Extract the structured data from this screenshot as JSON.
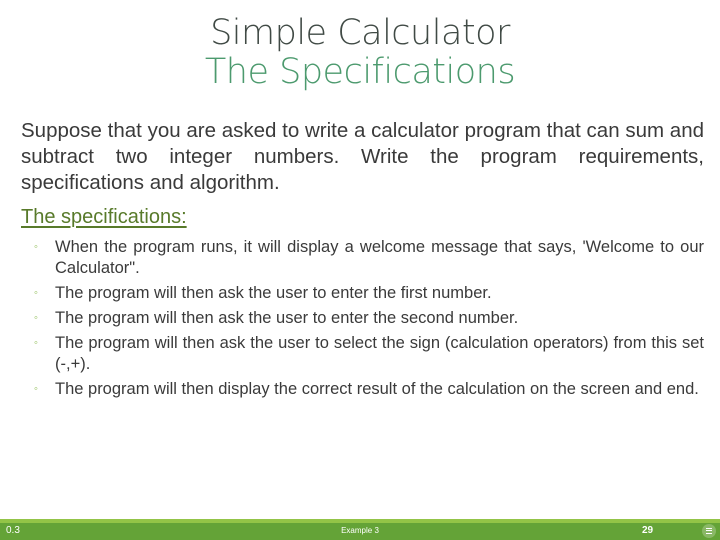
{
  "slide": {
    "title_line1": "Simple Calculator",
    "title_line2": "The Specifications",
    "intro": "Suppose that you are asked to write a calculator program that can sum and subtract two integer numbers. Write the program requirements, specifications and algorithm.",
    "spec_heading": "The specifications:",
    "bullet_glyph": "◦",
    "spec_items": [
      "When the program runs, it will display a welcome message that says, 'Welcome to our Calculator\".",
      "The program will then ask the user to enter the first number.",
      "The program will then ask the user to enter the second number.",
      "The program will then ask the user to select the sign (calculation operators) from this set (-,+).",
      "The program will then display the correct result of the calculation on the screen and end."
    ]
  },
  "footer": {
    "section": "0.3",
    "label": "Example 3",
    "page_number": "29",
    "menu_icon": "menu-icon"
  },
  "colors": {
    "title_gray": "#404a45",
    "title_green": "#4c9a6e",
    "heading_green": "#587a2a",
    "bullet_green": "#8fbc55",
    "footer_green": "#64a337",
    "footer_accent": "#93c447"
  }
}
